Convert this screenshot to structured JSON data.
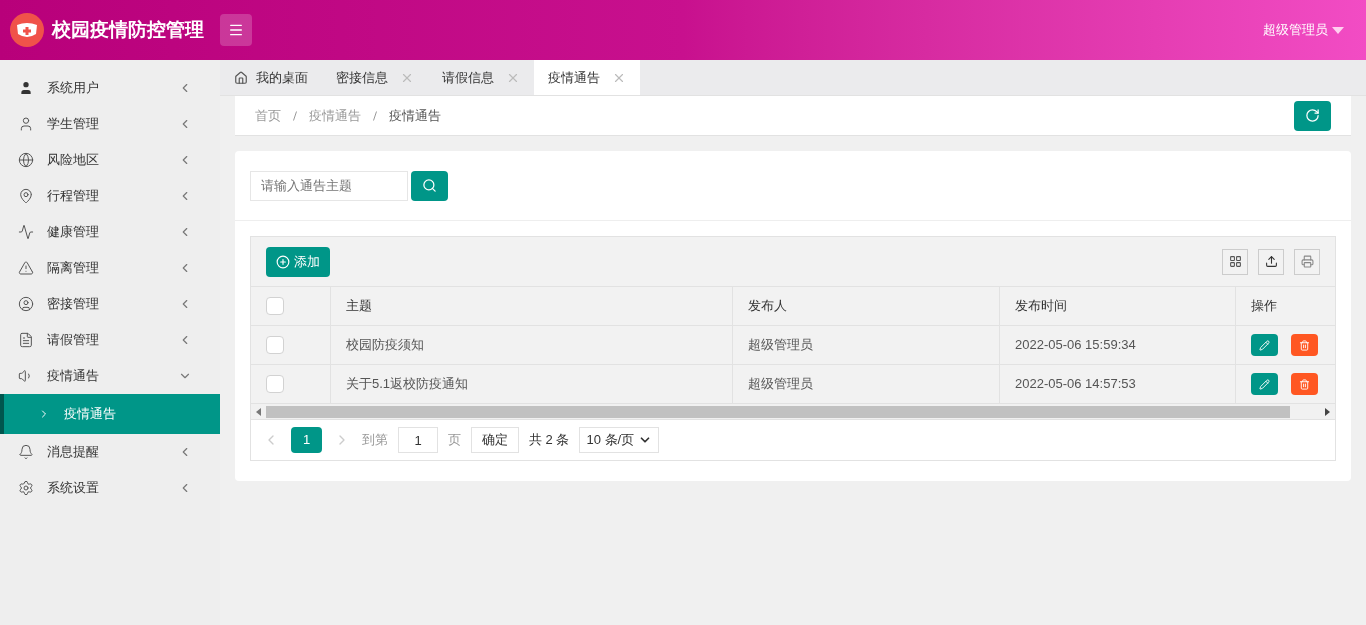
{
  "header": {
    "title": "校园疫情防控管理",
    "user": "超级管理员"
  },
  "sidebar": {
    "items": [
      {
        "label": "系统用户",
        "expanded": false
      },
      {
        "label": "学生管理",
        "expanded": false
      },
      {
        "label": "风险地区",
        "expanded": false
      },
      {
        "label": "行程管理",
        "expanded": false
      },
      {
        "label": "健康管理",
        "expanded": false
      },
      {
        "label": "隔离管理",
        "expanded": false
      },
      {
        "label": "密接管理",
        "expanded": false
      },
      {
        "label": "请假管理",
        "expanded": false
      },
      {
        "label": "疫情通告",
        "expanded": true,
        "children": [
          {
            "label": "疫情通告",
            "selected": true
          }
        ]
      },
      {
        "label": "消息提醒",
        "expanded": false
      },
      {
        "label": "系统设置",
        "expanded": false
      }
    ]
  },
  "tabs": [
    {
      "label": "我的桌面",
      "kind": "home",
      "selected": false
    },
    {
      "label": "密接信息",
      "kind": "page",
      "selected": false
    },
    {
      "label": "请假信息",
      "kind": "page",
      "selected": false
    },
    {
      "label": "疫情通告",
      "kind": "page",
      "selected": true
    }
  ],
  "breadcrumb": [
    "首页",
    "疫情通告",
    "疫情通告"
  ],
  "search": {
    "placeholder": "请输入通告主题"
  },
  "toolbar": {
    "add": "添加"
  },
  "table": {
    "select_all_checked": false,
    "columns": [
      "主题",
      "发布人",
      "发布时间",
      "操作"
    ],
    "rows": [
      {
        "checked": false,
        "cells": [
          "校园防疫须知",
          "超级管理员",
          "2022-05-06 15:59:34"
        ]
      },
      {
        "checked": false,
        "cells": [
          "关于5.1返校防疫通知",
          "超级管理员",
          "2022-05-06 14:57:53"
        ]
      }
    ]
  },
  "pagination": {
    "pages": [
      {
        "label": "1",
        "selected": true
      }
    ],
    "goto_label": "到第",
    "goto_value": "1",
    "page_unit": "页",
    "confirm": "确定",
    "total": "共 2 条",
    "page_size": "10 条/页"
  }
}
